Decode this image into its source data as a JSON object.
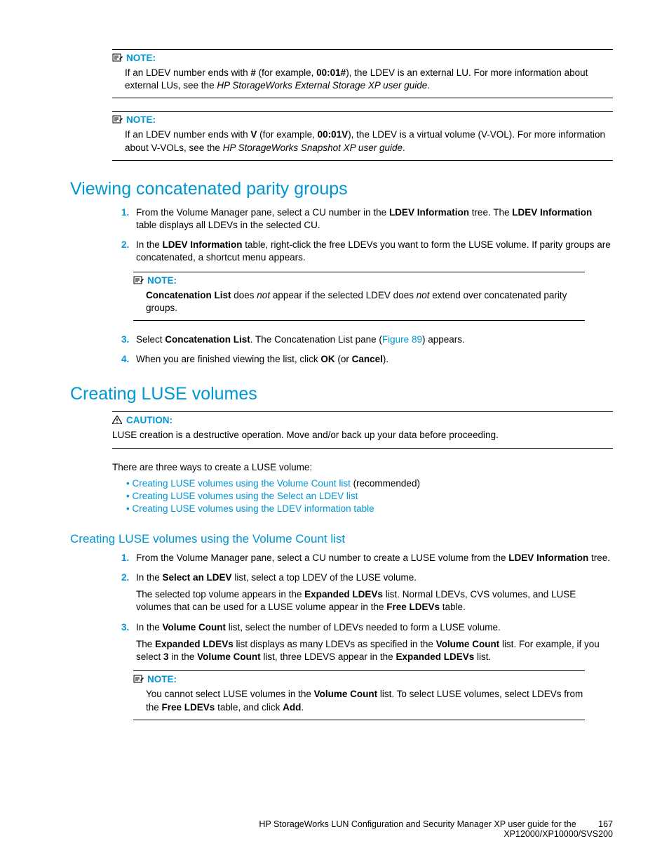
{
  "notes": {
    "label": "NOTE:",
    "n1_a": "If an LDEV number ends with ",
    "n1_b": "#",
    "n1_c": " (for example, ",
    "n1_d": "00:01#",
    "n1_e": "), the LDEV is an external LU. For more information about external LUs, see the ",
    "n1_f": "HP StorageWorks External Storage XP user guide",
    "n1_g": ".",
    "n2_a": "If an LDEV number ends with ",
    "n2_b": "V",
    "n2_c": " (for example, ",
    "n2_d": "00:01V",
    "n2_e": "), the LDEV is a virtual volume (V-VOL). For more information about V-VOLs, see the ",
    "n2_f": "HP StorageWorks Snapshot XP user guide",
    "n2_g": ".",
    "n3_a": "Concatenation List",
    "n3_b": " does ",
    "n3_c": "not",
    "n3_d": " appear if the selected LDEV does ",
    "n3_e": "not",
    "n3_f": " extend over concatenated parity groups.",
    "n4_a": "You cannot select LUSE volumes in the ",
    "n4_b": "Volume Count",
    "n4_c": " list. To select LUSE volumes, select LDEVs from the ",
    "n4_d": "Free LDEVs",
    "n4_e": " table, and click ",
    "n4_f": "Add",
    "n4_g": "."
  },
  "headings": {
    "h1": "Viewing concatenated parity groups",
    "h2": "Creating LUSE volumes",
    "h3": "Creating LUSE volumes using the Volume Count list"
  },
  "steps_a": {
    "s1_a": "From the Volume Manager pane, select a CU number in the ",
    "s1_b": "LDEV Information",
    "s1_c": " tree. The ",
    "s1_d": "LDEV Information",
    "s1_e": " table displays all LDEVs in the selected CU.",
    "s2_a": "In the ",
    "s2_b": "LDEV Information",
    "s2_c": " table, right-click the free LDEVs you want to form the LUSE volume. If parity groups are concatenated, a shortcut menu appears.",
    "s3_a": "Select ",
    "s3_b": "Concatenation List",
    "s3_c": ". The Concatenation List pane (",
    "s3_d": "Figure 89",
    "s3_e": ") appears.",
    "s4_a": "When you are finished viewing the list, click ",
    "s4_b": "OK",
    "s4_c": " (or ",
    "s4_d": "Cancel",
    "s4_e": ")."
  },
  "caution": {
    "label": "CAUTION:",
    "body": "LUSE creation is a destructive operation. Move and/or back up your data before proceeding."
  },
  "luse_intro": "There are three ways to create a LUSE volume:",
  "luse_links": {
    "l1": "Creating LUSE volumes using the Volume Count list",
    "l1_suffix": " (recommended)",
    "l2": "Creating LUSE volumes using the Select an LDEV list",
    "l3": "Creating LUSE volumes using the LDEV information table"
  },
  "steps_b": {
    "s1_a": "From the Volume Manager pane, select a CU number to create a LUSE volume from the ",
    "s1_b": "LDEV Information",
    "s1_c": " tree.",
    "s2_a": "In the ",
    "s2_b": "Select an LDEV",
    "s2_c": " list, select a top LDEV of the LUSE volume.",
    "s2p_a": "The selected top volume appears in the ",
    "s2p_b": "Expanded LDEVs",
    "s2p_c": " list. Normal LDEVs, CVS volumes, and LUSE volumes that can be used for a LUSE volume appear in the ",
    "s2p_d": "Free LDEVs",
    "s2p_e": " table.",
    "s3_a": "In the ",
    "s3_b": "Volume Count",
    "s3_c": " list, select the number of LDEVs needed to form a LUSE volume.",
    "s3p_a": "The ",
    "s3p_b": "Expanded LDEVs",
    "s3p_c": " list displays as many LDEVs as specified in the ",
    "s3p_d": "Volume Count",
    "s3p_e": " list. For example, if you select ",
    "s3p_f": "3",
    "s3p_g": " in the ",
    "s3p_h": "Volume Count",
    "s3p_i": " list, three LDEVS appear in the ",
    "s3p_j": "Expanded LDEVs",
    "s3p_k": " list."
  },
  "footer": {
    "line1": "HP StorageWorks LUN Configuration and Security Manager XP user guide for the",
    "line2": "XP12000/XP10000/SVS200",
    "page": "167"
  }
}
